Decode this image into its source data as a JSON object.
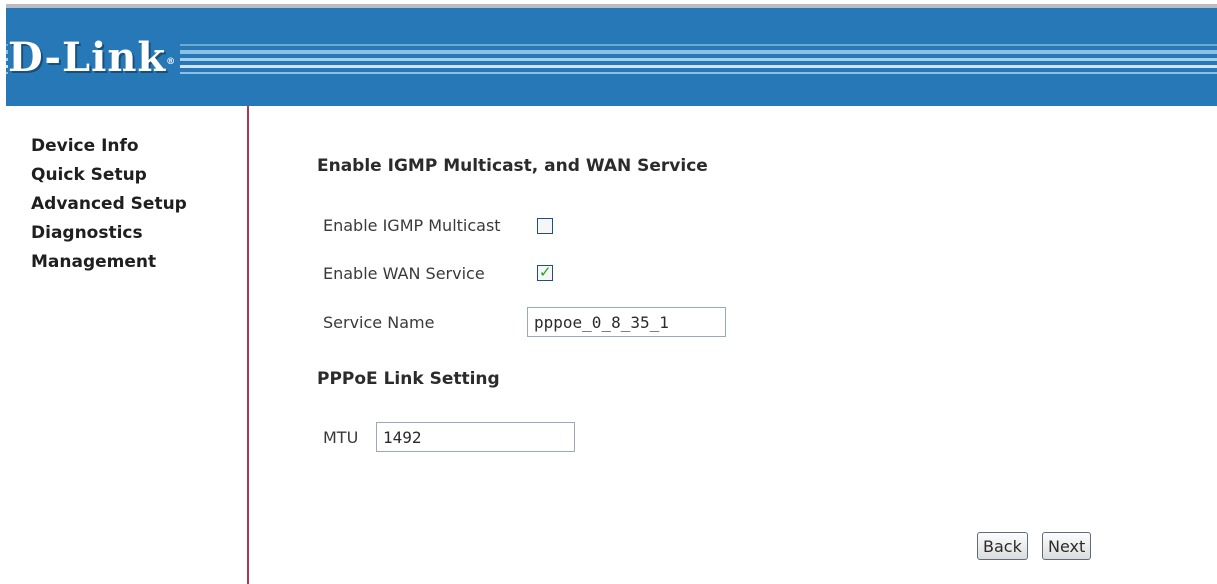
{
  "header": {
    "logo_text": "D-Link",
    "logo_mark": "®"
  },
  "sidebar": {
    "items": [
      {
        "label": "Device Info"
      },
      {
        "label": "Quick Setup"
      },
      {
        "label": "Advanced Setup"
      },
      {
        "label": "Diagnostics"
      },
      {
        "label": "Management"
      }
    ]
  },
  "main": {
    "section1_title": "Enable IGMP Multicast, and WAN Service",
    "igmp_label": "Enable IGMP Multicast",
    "igmp_checked": false,
    "wan_label": "Enable WAN Service",
    "wan_checked": true,
    "service_name_label": "Service Name",
    "service_name_value": "pppoe_0_8_35_1",
    "section2_title": "PPPoE Link Setting",
    "mtu_label": "MTU",
    "mtu_value": "1492"
  },
  "buttons": {
    "back_label": "Back",
    "next_label": "Next"
  },
  "colors": {
    "banner": "#2679b6",
    "sidebar_border": "#b0384c",
    "checkmark": "#21a121"
  },
  "icons": {
    "checkmark": "check-icon"
  }
}
